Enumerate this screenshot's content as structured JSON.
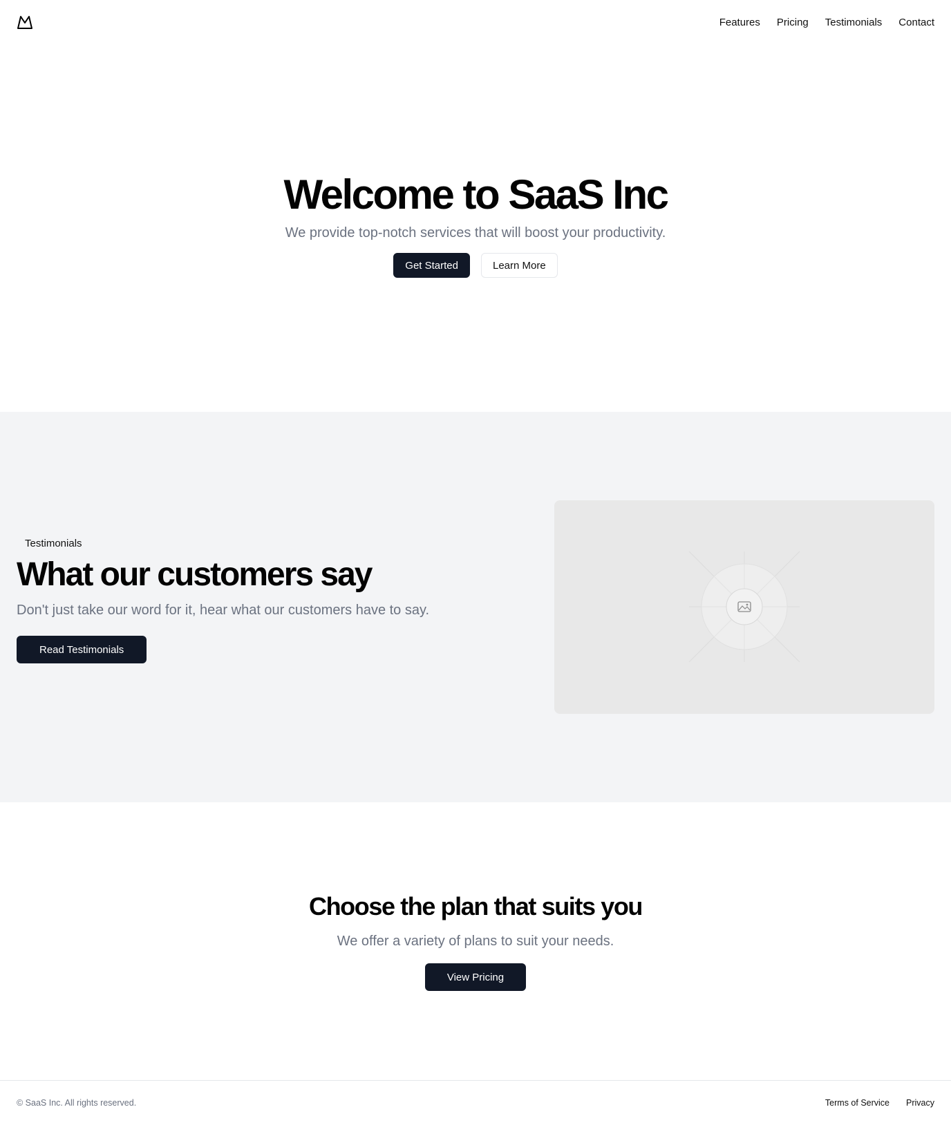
{
  "header": {
    "logo_icon": "mountain-icon",
    "nav": [
      {
        "label": "Features"
      },
      {
        "label": "Pricing"
      },
      {
        "label": "Testimonials"
      },
      {
        "label": "Contact"
      }
    ]
  },
  "hero": {
    "title": "Welcome to SaaS Inc",
    "subtitle": "We provide top-notch services that will boost your productivity.",
    "primary_button": "Get Started",
    "secondary_button": "Learn More"
  },
  "testimonials": {
    "badge": "Testimonials",
    "title": "What our customers say",
    "description": "Don't just take our word for it, hear what our customers have to say.",
    "button": "Read Testimonials",
    "image_icon": "image-placeholder-icon"
  },
  "pricing": {
    "title": "Choose the plan that suits you",
    "subtitle": "We offer a variety of plans to suit your needs.",
    "button": "View Pricing"
  },
  "footer": {
    "copyright": "© SaaS Inc. All rights reserved.",
    "links": [
      {
        "label": "Terms of Service"
      },
      {
        "label": "Privacy"
      }
    ]
  },
  "colors": {
    "primary_button_bg": "#111827",
    "muted_text": "#6b7280",
    "section_bg": "#f3f4f6",
    "placeholder_bg": "#e8e8e8"
  }
}
